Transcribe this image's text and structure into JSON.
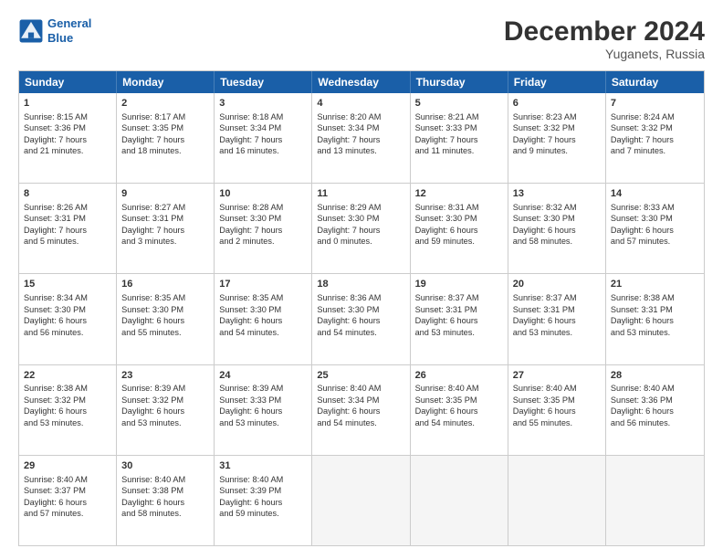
{
  "logo": {
    "line1": "General",
    "line2": "Blue"
  },
  "title": "December 2024",
  "subtitle": "Yuganets, Russia",
  "header_days": [
    "Sunday",
    "Monday",
    "Tuesday",
    "Wednesday",
    "Thursday",
    "Friday",
    "Saturday"
  ],
  "weeks": [
    [
      {
        "day": "1",
        "lines": [
          "Sunrise: 8:15 AM",
          "Sunset: 3:36 PM",
          "Daylight: 7 hours",
          "and 21 minutes."
        ]
      },
      {
        "day": "2",
        "lines": [
          "Sunrise: 8:17 AM",
          "Sunset: 3:35 PM",
          "Daylight: 7 hours",
          "and 18 minutes."
        ]
      },
      {
        "day": "3",
        "lines": [
          "Sunrise: 8:18 AM",
          "Sunset: 3:34 PM",
          "Daylight: 7 hours",
          "and 16 minutes."
        ]
      },
      {
        "day": "4",
        "lines": [
          "Sunrise: 8:20 AM",
          "Sunset: 3:34 PM",
          "Daylight: 7 hours",
          "and 13 minutes."
        ]
      },
      {
        "day": "5",
        "lines": [
          "Sunrise: 8:21 AM",
          "Sunset: 3:33 PM",
          "Daylight: 7 hours",
          "and 11 minutes."
        ]
      },
      {
        "day": "6",
        "lines": [
          "Sunrise: 8:23 AM",
          "Sunset: 3:32 PM",
          "Daylight: 7 hours",
          "and 9 minutes."
        ]
      },
      {
        "day": "7",
        "lines": [
          "Sunrise: 8:24 AM",
          "Sunset: 3:32 PM",
          "Daylight: 7 hours",
          "and 7 minutes."
        ]
      }
    ],
    [
      {
        "day": "8",
        "lines": [
          "Sunrise: 8:26 AM",
          "Sunset: 3:31 PM",
          "Daylight: 7 hours",
          "and 5 minutes."
        ]
      },
      {
        "day": "9",
        "lines": [
          "Sunrise: 8:27 AM",
          "Sunset: 3:31 PM",
          "Daylight: 7 hours",
          "and 3 minutes."
        ]
      },
      {
        "day": "10",
        "lines": [
          "Sunrise: 8:28 AM",
          "Sunset: 3:30 PM",
          "Daylight: 7 hours",
          "and 2 minutes."
        ]
      },
      {
        "day": "11",
        "lines": [
          "Sunrise: 8:29 AM",
          "Sunset: 3:30 PM",
          "Daylight: 7 hours",
          "and 0 minutes."
        ]
      },
      {
        "day": "12",
        "lines": [
          "Sunrise: 8:31 AM",
          "Sunset: 3:30 PM",
          "Daylight: 6 hours",
          "and 59 minutes."
        ]
      },
      {
        "day": "13",
        "lines": [
          "Sunrise: 8:32 AM",
          "Sunset: 3:30 PM",
          "Daylight: 6 hours",
          "and 58 minutes."
        ]
      },
      {
        "day": "14",
        "lines": [
          "Sunrise: 8:33 AM",
          "Sunset: 3:30 PM",
          "Daylight: 6 hours",
          "and 57 minutes."
        ]
      }
    ],
    [
      {
        "day": "15",
        "lines": [
          "Sunrise: 8:34 AM",
          "Sunset: 3:30 PM",
          "Daylight: 6 hours",
          "and 56 minutes."
        ]
      },
      {
        "day": "16",
        "lines": [
          "Sunrise: 8:35 AM",
          "Sunset: 3:30 PM",
          "Daylight: 6 hours",
          "and 55 minutes."
        ]
      },
      {
        "day": "17",
        "lines": [
          "Sunrise: 8:35 AM",
          "Sunset: 3:30 PM",
          "Daylight: 6 hours",
          "and 54 minutes."
        ]
      },
      {
        "day": "18",
        "lines": [
          "Sunrise: 8:36 AM",
          "Sunset: 3:30 PM",
          "Daylight: 6 hours",
          "and 54 minutes."
        ]
      },
      {
        "day": "19",
        "lines": [
          "Sunrise: 8:37 AM",
          "Sunset: 3:31 PM",
          "Daylight: 6 hours",
          "and 53 minutes."
        ]
      },
      {
        "day": "20",
        "lines": [
          "Sunrise: 8:37 AM",
          "Sunset: 3:31 PM",
          "Daylight: 6 hours",
          "and 53 minutes."
        ]
      },
      {
        "day": "21",
        "lines": [
          "Sunrise: 8:38 AM",
          "Sunset: 3:31 PM",
          "Daylight: 6 hours",
          "and 53 minutes."
        ]
      }
    ],
    [
      {
        "day": "22",
        "lines": [
          "Sunrise: 8:38 AM",
          "Sunset: 3:32 PM",
          "Daylight: 6 hours",
          "and 53 minutes."
        ]
      },
      {
        "day": "23",
        "lines": [
          "Sunrise: 8:39 AM",
          "Sunset: 3:32 PM",
          "Daylight: 6 hours",
          "and 53 minutes."
        ]
      },
      {
        "day": "24",
        "lines": [
          "Sunrise: 8:39 AM",
          "Sunset: 3:33 PM",
          "Daylight: 6 hours",
          "and 53 minutes."
        ]
      },
      {
        "day": "25",
        "lines": [
          "Sunrise: 8:40 AM",
          "Sunset: 3:34 PM",
          "Daylight: 6 hours",
          "and 54 minutes."
        ]
      },
      {
        "day": "26",
        "lines": [
          "Sunrise: 8:40 AM",
          "Sunset: 3:35 PM",
          "Daylight: 6 hours",
          "and 54 minutes."
        ]
      },
      {
        "day": "27",
        "lines": [
          "Sunrise: 8:40 AM",
          "Sunset: 3:35 PM",
          "Daylight: 6 hours",
          "and 55 minutes."
        ]
      },
      {
        "day": "28",
        "lines": [
          "Sunrise: 8:40 AM",
          "Sunset: 3:36 PM",
          "Daylight: 6 hours",
          "and 56 minutes."
        ]
      }
    ],
    [
      {
        "day": "29",
        "lines": [
          "Sunrise: 8:40 AM",
          "Sunset: 3:37 PM",
          "Daylight: 6 hours",
          "and 57 minutes."
        ]
      },
      {
        "day": "30",
        "lines": [
          "Sunrise: 8:40 AM",
          "Sunset: 3:38 PM",
          "Daylight: 6 hours",
          "and 58 minutes."
        ]
      },
      {
        "day": "31",
        "lines": [
          "Sunrise: 8:40 AM",
          "Sunset: 3:39 PM",
          "Daylight: 6 hours",
          "and 59 minutes."
        ]
      },
      null,
      null,
      null,
      null
    ]
  ]
}
